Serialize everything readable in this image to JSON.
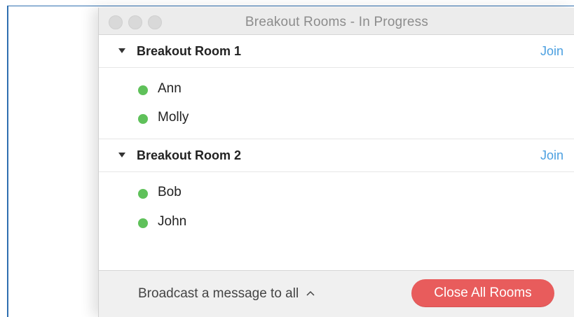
{
  "window": {
    "title": "Breakout Rooms - In Progress"
  },
  "rooms": [
    {
      "name": "Breakout Room 1",
      "join_label": "Join",
      "participants": [
        "Ann",
        "Molly"
      ]
    },
    {
      "name": "Breakout Room 2",
      "join_label": "Join",
      "participants": [
        "Bob",
        "John"
      ]
    }
  ],
  "footer": {
    "broadcast_label": "Broadcast a message to all",
    "broadcast_icon": "chevron-up-icon",
    "close_all_label": "Close All Rooms"
  },
  "colors": {
    "join_link": "#4a9fe0",
    "participant_dot": "#5fc15a",
    "close_button": "#e85c5c",
    "window_border_accent": "#2f6fb0"
  }
}
